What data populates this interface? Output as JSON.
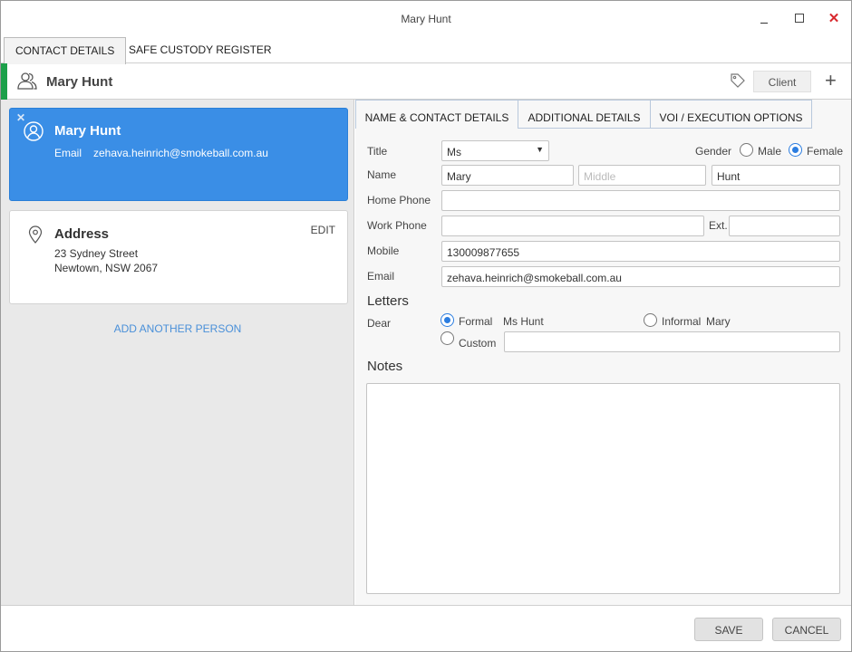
{
  "window": {
    "title": "Mary Hunt",
    "controls": {
      "minimize": "minimize-icon",
      "maximize": "maximize-icon",
      "close": "close-icon",
      "close_glyph": "✕"
    }
  },
  "top_tabs": [
    {
      "label": "CONTACT DETAILS",
      "active": true
    },
    {
      "label": "SAFE CUSTODY REGISTER",
      "active": false
    }
  ],
  "header": {
    "name": "Mary Hunt",
    "role_button": "Client",
    "add_glyph": "+",
    "accent_color": "#1ca04a"
  },
  "person_card": {
    "name": "Mary Hunt",
    "email_label": "Email",
    "email": "zehava.heinrich@smokeball.com.au",
    "remove_glyph": "✕",
    "color": "#3a8ee6"
  },
  "address_card": {
    "title": "Address",
    "edit_label": "EDIT",
    "line1": "23 Sydney Street",
    "line2": "Newtown, NSW 2067"
  },
  "add_person_label": "ADD ANOTHER PERSON",
  "inner_tabs": [
    {
      "label": "NAME & CONTACT DETAILS",
      "active": true
    },
    {
      "label": "ADDITIONAL DETAILS",
      "active": false
    },
    {
      "label": "VOI / EXECUTION OPTIONS",
      "active": false
    }
  ],
  "form": {
    "title_label": "Title",
    "title_value": "Ms",
    "gender_label": "Gender",
    "gender_options": [
      "Male",
      "Female"
    ],
    "gender_selected": "Female",
    "name_label": "Name",
    "first_name": "Mary",
    "middle_placeholder": "Middle",
    "last_name": "Hunt",
    "home_phone_label": "Home Phone",
    "home_phone": "",
    "work_phone_label": "Work Phone",
    "work_phone": "",
    "ext_label": "Ext.",
    "ext": "",
    "mobile_label": "Mobile",
    "mobile": "130009877655",
    "email_label": "Email",
    "email": "zehava.heinrich@smokeball.com.au"
  },
  "letters": {
    "section_title": "Letters",
    "dear_label": "Dear",
    "formal_label": "Formal",
    "formal_value": "Ms Hunt",
    "informal_label": "Informal",
    "informal_value": "Mary",
    "custom_label": "Custom",
    "custom_value": "",
    "selected": "Formal"
  },
  "notes": {
    "section_title": "Notes",
    "value": ""
  },
  "footer": {
    "save_label": "SAVE",
    "cancel_label": "CANCEL"
  }
}
